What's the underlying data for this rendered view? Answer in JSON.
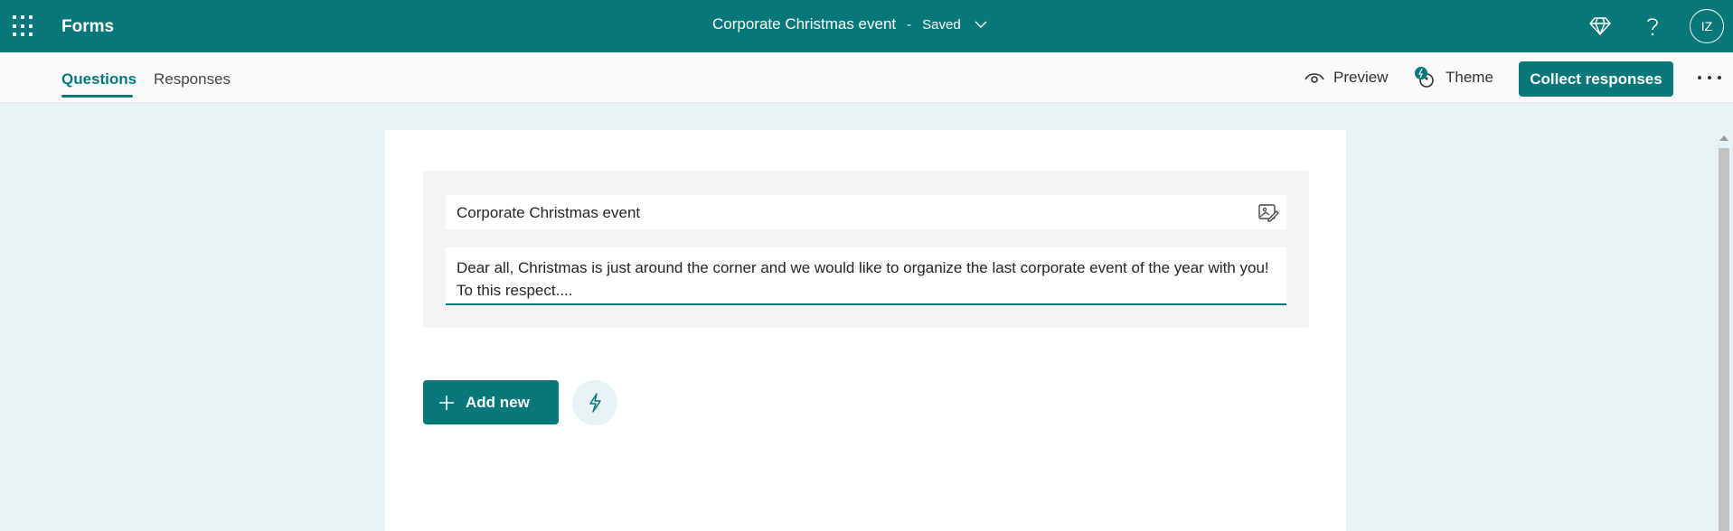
{
  "topbar": {
    "app_name": "Forms",
    "form_title": "Corporate Christmas event",
    "separator": "-",
    "status": "Saved",
    "avatar_initials": "IZ",
    "icons": [
      "waffle-icon",
      "diamond-icon",
      "help-icon",
      "chevron-down-icon"
    ]
  },
  "subnav": {
    "tabs": [
      {
        "label": "Questions",
        "active": true
      },
      {
        "label": "Responses",
        "active": false
      }
    ],
    "preview_label": "Preview",
    "theme_label": "Theme",
    "collect_label": "Collect responses"
  },
  "form": {
    "title": "Corporate Christmas event",
    "description": "Dear all, Christmas is just around the corner and we would like to organize the last corporate event of the year with you! To this respect...."
  },
  "actions": {
    "add_new_label": "Add new"
  },
  "colors": {
    "brand": "#077779",
    "canvas_bg": "#e8f1f3"
  }
}
